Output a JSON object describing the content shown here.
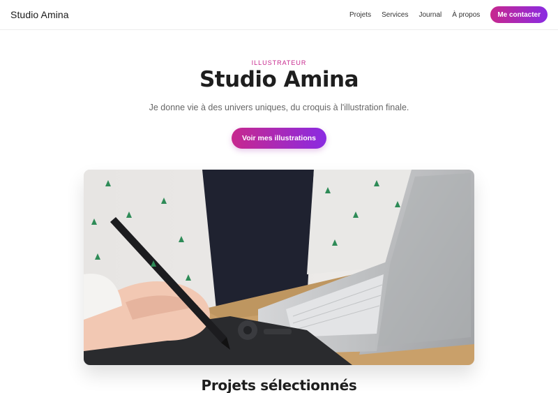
{
  "header": {
    "brand": "Studio Amina",
    "nav": [
      {
        "label": "Projets"
      },
      {
        "label": "Services"
      },
      {
        "label": "Journal"
      },
      {
        "label": "À propos"
      }
    ],
    "cta_label": "Me contacter"
  },
  "hero": {
    "eyebrow": "ILLUSTRATEUR",
    "title": "Studio Amina",
    "subtitle": "Je donne vie à des univers uniques, du croquis à l'illustration finale.",
    "cta_label": "Voir mes illustrations"
  },
  "projects": {
    "title": "Projets sélectionnés"
  },
  "colors": {
    "accent_start": "#c7288e",
    "accent_end": "#8a2be2",
    "eyebrow": "#c7288e"
  }
}
